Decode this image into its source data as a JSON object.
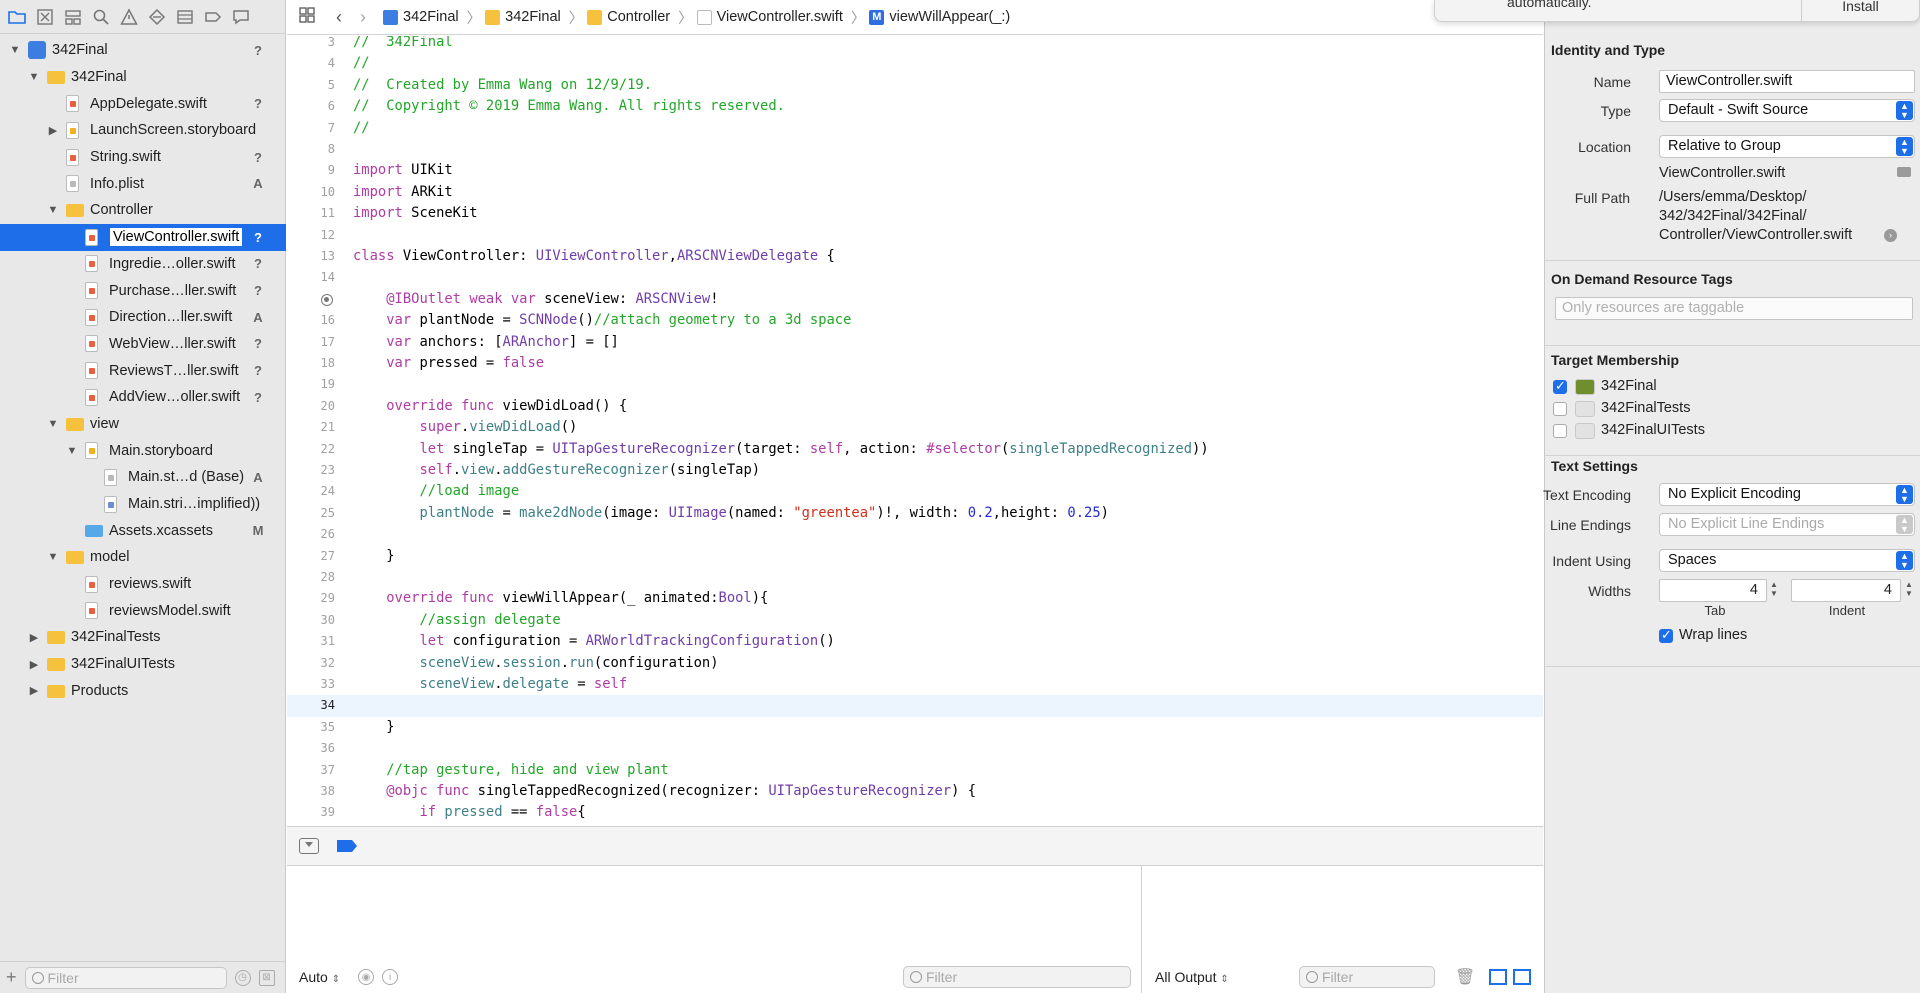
{
  "navigator": {
    "toolbar_icons": [
      "folder-icon",
      "source-control-icon",
      "symbol-icon",
      "find-icon",
      "issue-icon",
      "test-icon",
      "debug-icon",
      "breakpoint-icon",
      "report-icon"
    ],
    "tree": [
      {
        "label": "342Final",
        "level": 0,
        "expanded": true,
        "icon": "project",
        "status": "?"
      },
      {
        "label": "342Final",
        "level": 1,
        "expanded": true,
        "icon": "folder",
        "status": ""
      },
      {
        "label": "AppDelegate.swift",
        "level": 2,
        "icon": "swift",
        "status": "?"
      },
      {
        "label": "LaunchScreen.storyboard",
        "level": 2,
        "collapsed": true,
        "icon": "storyboard",
        "status": ""
      },
      {
        "label": "String.swift",
        "level": 2,
        "icon": "swift",
        "status": "?"
      },
      {
        "label": "Info.plist",
        "level": 2,
        "icon": "plain",
        "status": "A"
      },
      {
        "label": "Controller",
        "level": 2,
        "expanded": true,
        "icon": "folder",
        "status": ""
      },
      {
        "label": "ViewController.swift",
        "level": 3,
        "icon": "swift",
        "status": "?",
        "selected": true
      },
      {
        "label": "Ingredie…oller.swift",
        "level": 3,
        "icon": "swift",
        "status": "?"
      },
      {
        "label": "Purchase…ller.swift",
        "level": 3,
        "icon": "swift",
        "status": "?"
      },
      {
        "label": "Direction…ller.swift",
        "level": 3,
        "icon": "swift",
        "status": "A"
      },
      {
        "label": "WebView…ller.swift",
        "level": 3,
        "icon": "swift",
        "status": "?"
      },
      {
        "label": "ReviewsT…ller.swift",
        "level": 3,
        "icon": "swift",
        "status": "?"
      },
      {
        "label": "AddView…oller.swift",
        "level": 3,
        "icon": "swift",
        "status": "?"
      },
      {
        "label": "view",
        "level": 2,
        "expanded": true,
        "icon": "folder",
        "status": ""
      },
      {
        "label": "Main.storyboard",
        "level": 3,
        "expanded": true,
        "icon": "storyboard",
        "status": ""
      },
      {
        "label": "Main.st…d (Base)",
        "level": 4,
        "icon": "plain",
        "status": "A"
      },
      {
        "label": "Main.stri…implified))",
        "level": 4,
        "icon": "strings",
        "status": ""
      },
      {
        "label": "Assets.xcassets",
        "level": 3,
        "icon": "assets",
        "status": "M"
      },
      {
        "label": "model",
        "level": 2,
        "expanded": true,
        "icon": "folder",
        "status": ""
      },
      {
        "label": "reviews.swift",
        "level": 3,
        "icon": "swift",
        "status": ""
      },
      {
        "label": "reviewsModel.swift",
        "level": 3,
        "icon": "swift",
        "status": ""
      },
      {
        "label": "342FinalTests",
        "level": 1,
        "collapsed": true,
        "icon": "folder",
        "status": ""
      },
      {
        "label": "342FinalUITests",
        "level": 1,
        "collapsed": true,
        "icon": "folder",
        "status": ""
      },
      {
        "label": "Products",
        "level": 1,
        "collapsed": true,
        "icon": "folder",
        "status": ""
      }
    ],
    "filter_placeholder": "Filter"
  },
  "jumpbar": {
    "crumbs": [
      "342Final",
      "342Final",
      "Controller",
      "ViewController.swift",
      "viewWillAppear(_:)"
    ]
  },
  "editor": {
    "current_line": 34,
    "breakpoint_line": 15,
    "lines": [
      {
        "n": 3,
        "tokens": [
          [
            "c",
            "//  342Final"
          ]
        ]
      },
      {
        "n": 4,
        "tokens": [
          [
            "c",
            "//"
          ]
        ]
      },
      {
        "n": 5,
        "tokens": [
          [
            "c",
            "//  Created by Emma Wang on 12/9/19."
          ]
        ]
      },
      {
        "n": 6,
        "tokens": [
          [
            "c",
            "//  Copyright © 2019 Emma Wang. All rights reserved."
          ]
        ]
      },
      {
        "n": 7,
        "tokens": [
          [
            "c",
            "//"
          ]
        ]
      },
      {
        "n": 8,
        "tokens": []
      },
      {
        "n": 9,
        "tokens": [
          [
            "k",
            "import"
          ],
          [
            "p",
            " UIKit"
          ]
        ]
      },
      {
        "n": 10,
        "tokens": [
          [
            "k",
            "import"
          ],
          [
            "p",
            " ARKit"
          ]
        ]
      },
      {
        "n": 11,
        "tokens": [
          [
            "k",
            "import"
          ],
          [
            "p",
            " SceneKit"
          ]
        ]
      },
      {
        "n": 12,
        "tokens": []
      },
      {
        "n": 13,
        "tokens": [
          [
            "k",
            "class"
          ],
          [
            "p",
            " ViewController: "
          ],
          [
            "t",
            "UIViewController"
          ],
          [
            "p",
            ","
          ],
          [
            "t",
            "ARSCNViewDelegate"
          ],
          [
            "p",
            " {"
          ]
        ]
      },
      {
        "n": 14,
        "tokens": []
      },
      {
        "n": 15,
        "tokens": [
          [
            "p",
            "    "
          ],
          [
            "k",
            "@IBOutlet"
          ],
          [
            "p",
            " "
          ],
          [
            "k",
            "weak"
          ],
          [
            "p",
            " "
          ],
          [
            "k",
            "var"
          ],
          [
            "p",
            " sceneView: "
          ],
          [
            "t",
            "ARSCNView"
          ],
          [
            "p",
            "!"
          ]
        ]
      },
      {
        "n": 16,
        "tokens": [
          [
            "p",
            "    "
          ],
          [
            "k",
            "var"
          ],
          [
            "p",
            " plantNode = "
          ],
          [
            "t",
            "SCNNode"
          ],
          [
            "p",
            "()"
          ],
          [
            "c",
            "//attach geometry to a 3d space"
          ]
        ]
      },
      {
        "n": 17,
        "tokens": [
          [
            "p",
            "    "
          ],
          [
            "k",
            "var"
          ],
          [
            "p",
            " anchors: ["
          ],
          [
            "t",
            "ARAnchor"
          ],
          [
            "p",
            "] = []"
          ]
        ]
      },
      {
        "n": 18,
        "tokens": [
          [
            "p",
            "    "
          ],
          [
            "k",
            "var"
          ],
          [
            "p",
            " pressed = "
          ],
          [
            "k",
            "false"
          ]
        ]
      },
      {
        "n": 19,
        "tokens": []
      },
      {
        "n": 20,
        "tokens": [
          [
            "p",
            "    "
          ],
          [
            "k",
            "override"
          ],
          [
            "p",
            " "
          ],
          [
            "k",
            "func"
          ],
          [
            "p",
            " viewDidLoad() {"
          ]
        ]
      },
      {
        "n": 21,
        "tokens": [
          [
            "p",
            "        "
          ],
          [
            "k",
            "super"
          ],
          [
            "p",
            "."
          ],
          [
            "f",
            "viewDidLoad"
          ],
          [
            "p",
            "()"
          ]
        ]
      },
      {
        "n": 22,
        "tokens": [
          [
            "p",
            "        "
          ],
          [
            "k",
            "let"
          ],
          [
            "p",
            " singleTap = "
          ],
          [
            "t",
            "UITapGestureRecognizer"
          ],
          [
            "p",
            "(target: "
          ],
          [
            "k",
            "self"
          ],
          [
            "p",
            ", action: "
          ],
          [
            "k",
            "#selector"
          ],
          [
            "p",
            "("
          ],
          [
            "f",
            "singleTappedRecognized"
          ],
          [
            "p",
            "))"
          ]
        ]
      },
      {
        "n": 23,
        "tokens": [
          [
            "p",
            "        "
          ],
          [
            "k",
            "self"
          ],
          [
            "p",
            "."
          ],
          [
            "f",
            "view"
          ],
          [
            "p",
            "."
          ],
          [
            "f",
            "addGestureRecognizer"
          ],
          [
            "p",
            "(singleTap)"
          ]
        ]
      },
      {
        "n": 24,
        "tokens": [
          [
            "p",
            "        "
          ],
          [
            "c",
            "//load image"
          ]
        ]
      },
      {
        "n": 25,
        "tokens": [
          [
            "p",
            "        "
          ],
          [
            "f",
            "plantNode"
          ],
          [
            "p",
            " = "
          ],
          [
            "f",
            "make2dNode"
          ],
          [
            "p",
            "(image: "
          ],
          [
            "t",
            "UIImage"
          ],
          [
            "p",
            "(named: "
          ],
          [
            "s",
            "\"greentea\""
          ],
          [
            "p",
            ")!, width: "
          ],
          [
            "n",
            "0.2"
          ],
          [
            "p",
            ",height: "
          ],
          [
            "n",
            "0.25"
          ],
          [
            "p",
            ")"
          ]
        ]
      },
      {
        "n": 26,
        "tokens": []
      },
      {
        "n": 27,
        "tokens": [
          [
            "p",
            "    }"
          ]
        ]
      },
      {
        "n": 28,
        "tokens": []
      },
      {
        "n": 29,
        "tokens": [
          [
            "p",
            "    "
          ],
          [
            "k",
            "override"
          ],
          [
            "p",
            " "
          ],
          [
            "k",
            "func"
          ],
          [
            "p",
            " viewWillAppear(_ animated:"
          ],
          [
            "t",
            "Bool"
          ],
          [
            "p",
            "){"
          ]
        ]
      },
      {
        "n": 30,
        "tokens": [
          [
            "p",
            "        "
          ],
          [
            "c",
            "//assign delegate"
          ]
        ]
      },
      {
        "n": 31,
        "tokens": [
          [
            "p",
            "        "
          ],
          [
            "k",
            "let"
          ],
          [
            "p",
            " configuration = "
          ],
          [
            "t",
            "ARWorldTrackingConfiguration"
          ],
          [
            "p",
            "()"
          ]
        ]
      },
      {
        "n": 32,
        "tokens": [
          [
            "p",
            "        "
          ],
          [
            "f",
            "sceneView"
          ],
          [
            "p",
            "."
          ],
          [
            "f",
            "session"
          ],
          [
            "p",
            "."
          ],
          [
            "f",
            "run"
          ],
          [
            "p",
            "(configuration)"
          ]
        ]
      },
      {
        "n": 33,
        "tokens": [
          [
            "p",
            "        "
          ],
          [
            "f",
            "sceneView"
          ],
          [
            "p",
            "."
          ],
          [
            "f",
            "delegate"
          ],
          [
            "p",
            " = "
          ],
          [
            "k",
            "self"
          ]
        ]
      },
      {
        "n": 34,
        "tokens": []
      },
      {
        "n": 35,
        "tokens": [
          [
            "p",
            "    }"
          ]
        ]
      },
      {
        "n": 36,
        "tokens": []
      },
      {
        "n": 37,
        "tokens": [
          [
            "p",
            "    "
          ],
          [
            "c",
            "//tap gesture, hide and view plant"
          ]
        ]
      },
      {
        "n": 38,
        "tokens": [
          [
            "p",
            "    "
          ],
          [
            "k",
            "@objc"
          ],
          [
            "p",
            " "
          ],
          [
            "k",
            "func"
          ],
          [
            "p",
            " singleTappedRecognized(recognizer: "
          ],
          [
            "t",
            "UITapGestureRecognizer"
          ],
          [
            "p",
            ") {"
          ]
        ]
      },
      {
        "n": 39,
        "tokens": [
          [
            "p",
            "        "
          ],
          [
            "k",
            "if"
          ],
          [
            "p",
            " "
          ],
          [
            "f",
            "pressed"
          ],
          [
            "p",
            " == "
          ],
          [
            "k",
            "false"
          ],
          [
            "p",
            "{"
          ]
        ]
      }
    ]
  },
  "debug": {
    "variables_scope": "Auto",
    "variables_filter_placeholder": "Filter",
    "console_output": "All Output",
    "console_filter_placeholder": "Filter"
  },
  "install_banner": {
    "message": "automatically.",
    "button": "Install"
  },
  "inspector": {
    "identity_title": "Identity and Type",
    "name_label": "Name",
    "name_value": "ViewController.swift",
    "type_label": "Type",
    "type_value": "Default - Swift Source",
    "location_label": "Location",
    "location_value": "Relative to Group",
    "location_file": "ViewController.swift",
    "full_path_label": "Full Path",
    "full_path_lines": [
      "/Users/emma/Desktop/",
      "342/342Final/342Final/",
      "Controller/ViewController.swift"
    ],
    "odr_title": "On Demand Resource Tags",
    "odr_placeholder": "Only resources are taggable",
    "target_title": "Target Membership",
    "targets": [
      {
        "label": "342Final",
        "checked": true,
        "app": true
      },
      {
        "label": "342FinalTests",
        "checked": false,
        "app": false
      },
      {
        "label": "342FinalUITests",
        "checked": false,
        "app": false
      }
    ],
    "text_title": "Text Settings",
    "encoding_label": "Text Encoding",
    "encoding_value": "No Explicit Encoding",
    "line_endings_label": "Line Endings",
    "line_endings_value": "No Explicit Line Endings",
    "indent_using_label": "Indent Using",
    "indent_using_value": "Spaces",
    "widths_label": "Widths",
    "tab_width": "4",
    "indent_width": "4",
    "tab_caption": "Tab",
    "indent_caption": "Indent",
    "wrap_lines_label": "Wrap lines",
    "wrap_lines_checked": true
  },
  "colors": {
    "selection": "#1d6ee8",
    "keyword": "#ad3da4",
    "comment": "#23a629",
    "type": "#703daa",
    "string": "#d12f1b",
    "number": "#272ad8"
  }
}
